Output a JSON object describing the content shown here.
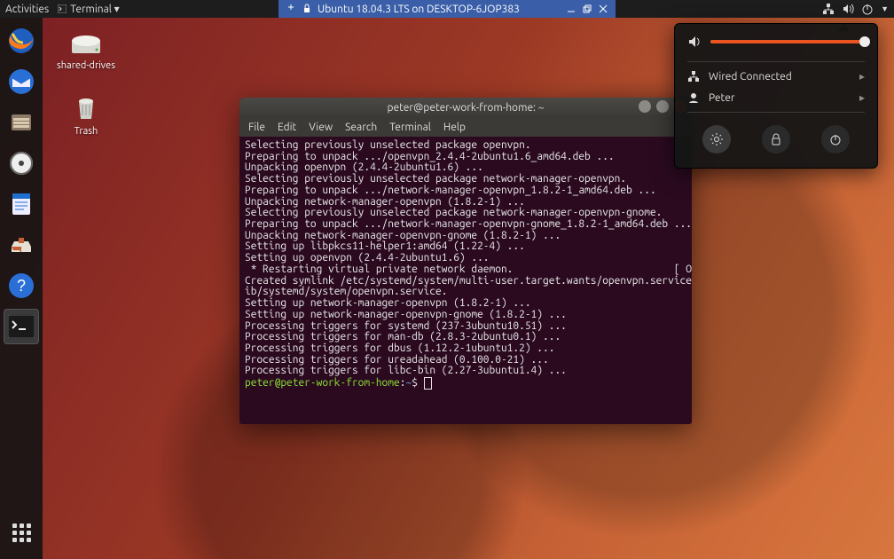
{
  "topbar": {
    "activities": "Activities",
    "app_menu": "Terminal ▾",
    "center_title": "Ubuntu 18.04.3 LTS on DESKTOP-6JOP383"
  },
  "desktop_icons": [
    {
      "label": "shared-drives"
    },
    {
      "label": "Trash"
    }
  ],
  "dock": {
    "items": [
      "firefox",
      "thunderbird",
      "files",
      "rhythmbox",
      "writer",
      "software",
      "help",
      "terminal"
    ]
  },
  "terminal": {
    "title": "peter@peter-work-from-home: ~",
    "menus": [
      "File",
      "Edit",
      "View",
      "Search",
      "Terminal",
      "Help"
    ],
    "lines": [
      "Selecting previously unselected package openvpn.",
      "Preparing to unpack .../openvpn_2.4.4-2ubuntu1.6_amd64.deb ...",
      "Unpacking openvpn (2.4.4-2ubuntu1.6) ...",
      "Selecting previously unselected package network-manager-openvpn.",
      "Preparing to unpack .../network-manager-openvpn_1.8.2-1_amd64.deb ...",
      "Unpacking network-manager-openvpn (1.8.2-1) ...",
      "Selecting previously unselected package network-manager-openvpn-gnome.",
      "Preparing to unpack .../network-manager-openvpn-gnome_1.8.2-1_amd64.deb ...",
      "Unpacking network-manager-openvpn-gnome (1.8.2-1) ...",
      "Setting up libpkcs11-helper1:amd64 (1.22-4) ...",
      "Setting up openvpn (2.4.4-2ubuntu1.6) ...",
      " * Restarting virtual private network daemon.                           [ OK ]",
      "Created symlink /etc/systemd/system/multi-user.target.wants/openvpn.service → /l",
      "ib/systemd/system/openvpn.service.",
      "Setting up network-manager-openvpn (1.8.2-1) ...",
      "Setting up network-manager-openvpn-gnome (1.8.2-1) ...",
      "Processing triggers for systemd (237-3ubuntu10.51) ...",
      "Processing triggers for man-db (2.8.3-2ubuntu0.1) ...",
      "Processing triggers for dbus (1.12.2-1ubuntu1.2) ...",
      "Processing triggers for ureadahead (0.100.0-21) ...",
      "Processing triggers for libc-bin (2.27-3ubuntu1.4) ..."
    ],
    "prompt_user": "peter@peter-work-from-home",
    "prompt_sep": ":",
    "prompt_path": "~",
    "prompt_dollar": "$"
  },
  "sysmenu": {
    "volume_percent": 100,
    "rows": [
      {
        "icon": "network",
        "label": "Wired Connected"
      },
      {
        "icon": "user",
        "label": "Peter"
      }
    ]
  }
}
